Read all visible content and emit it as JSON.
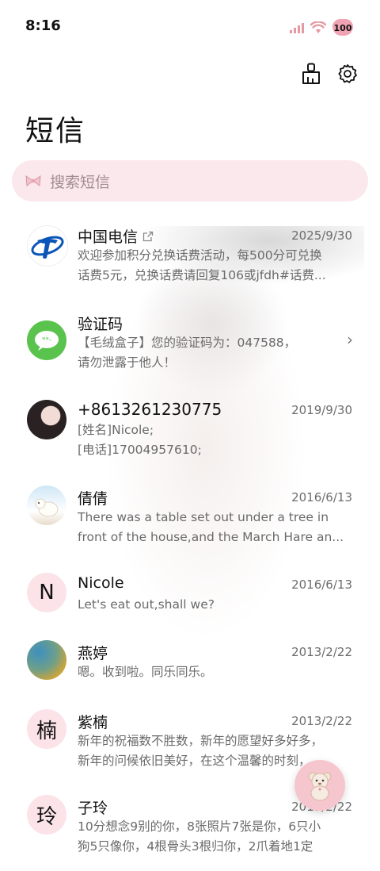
{
  "status": {
    "time": "8:16",
    "battery": "100"
  },
  "header": {
    "title": "短信"
  },
  "search": {
    "placeholder": "搜索短信"
  },
  "conversations": [
    {
      "name": "中国电信",
      "date": "2025/9/30",
      "line1": "欢迎参加积分兑换话费活动，每500分可兑换",
      "line2": "话费5元，兑换话费请回复106或jfdh#话费..."
    },
    {
      "name": "验证码",
      "date": "",
      "line1": "【毛绒盒子】您的验证码为：047588，",
      "line2": "请勿泄露于他人！"
    },
    {
      "name": "+8613261230775",
      "date": "2019/9/30",
      "line1": "[姓名]Nicole;",
      "line2": "[电话]17004957610;"
    },
    {
      "name": "倩倩",
      "date": "2016/6/13",
      "line1": "There was a table set out under a tree in",
      "line2": "front of the house,and the March Hare an..."
    },
    {
      "name": "Nicole",
      "avatar_letter": "N",
      "date": "2016/6/13",
      "line1": "Let's eat out,shall we?",
      "line2": ""
    },
    {
      "name": "燕婷",
      "date": "2013/2/22",
      "line1": "嗯。收到啦。同乐同乐。",
      "line2": ""
    },
    {
      "name": "紫楠",
      "avatar_letter": "楠",
      "date": "2013/2/22",
      "line1": "新年的祝福数不胜数，新年的愿望好多好多，",
      "line2": "新年的问候依旧美好，在这个温馨的时刻，..."
    },
    {
      "name": "子玲",
      "avatar_letter": "玲",
      "date": "2013/2/22",
      "line1": "10分想念9别的你，8张照片7张是你，6只小",
      "line2": "狗5只像你，4根骨头3根归你，2爪着地1定"
    }
  ],
  "colors": {
    "accent_pink": "#fbe8ec",
    "fab": "#f6c6cf",
    "telecom_blue": "#0a55b8",
    "green": "#5ac34d"
  }
}
